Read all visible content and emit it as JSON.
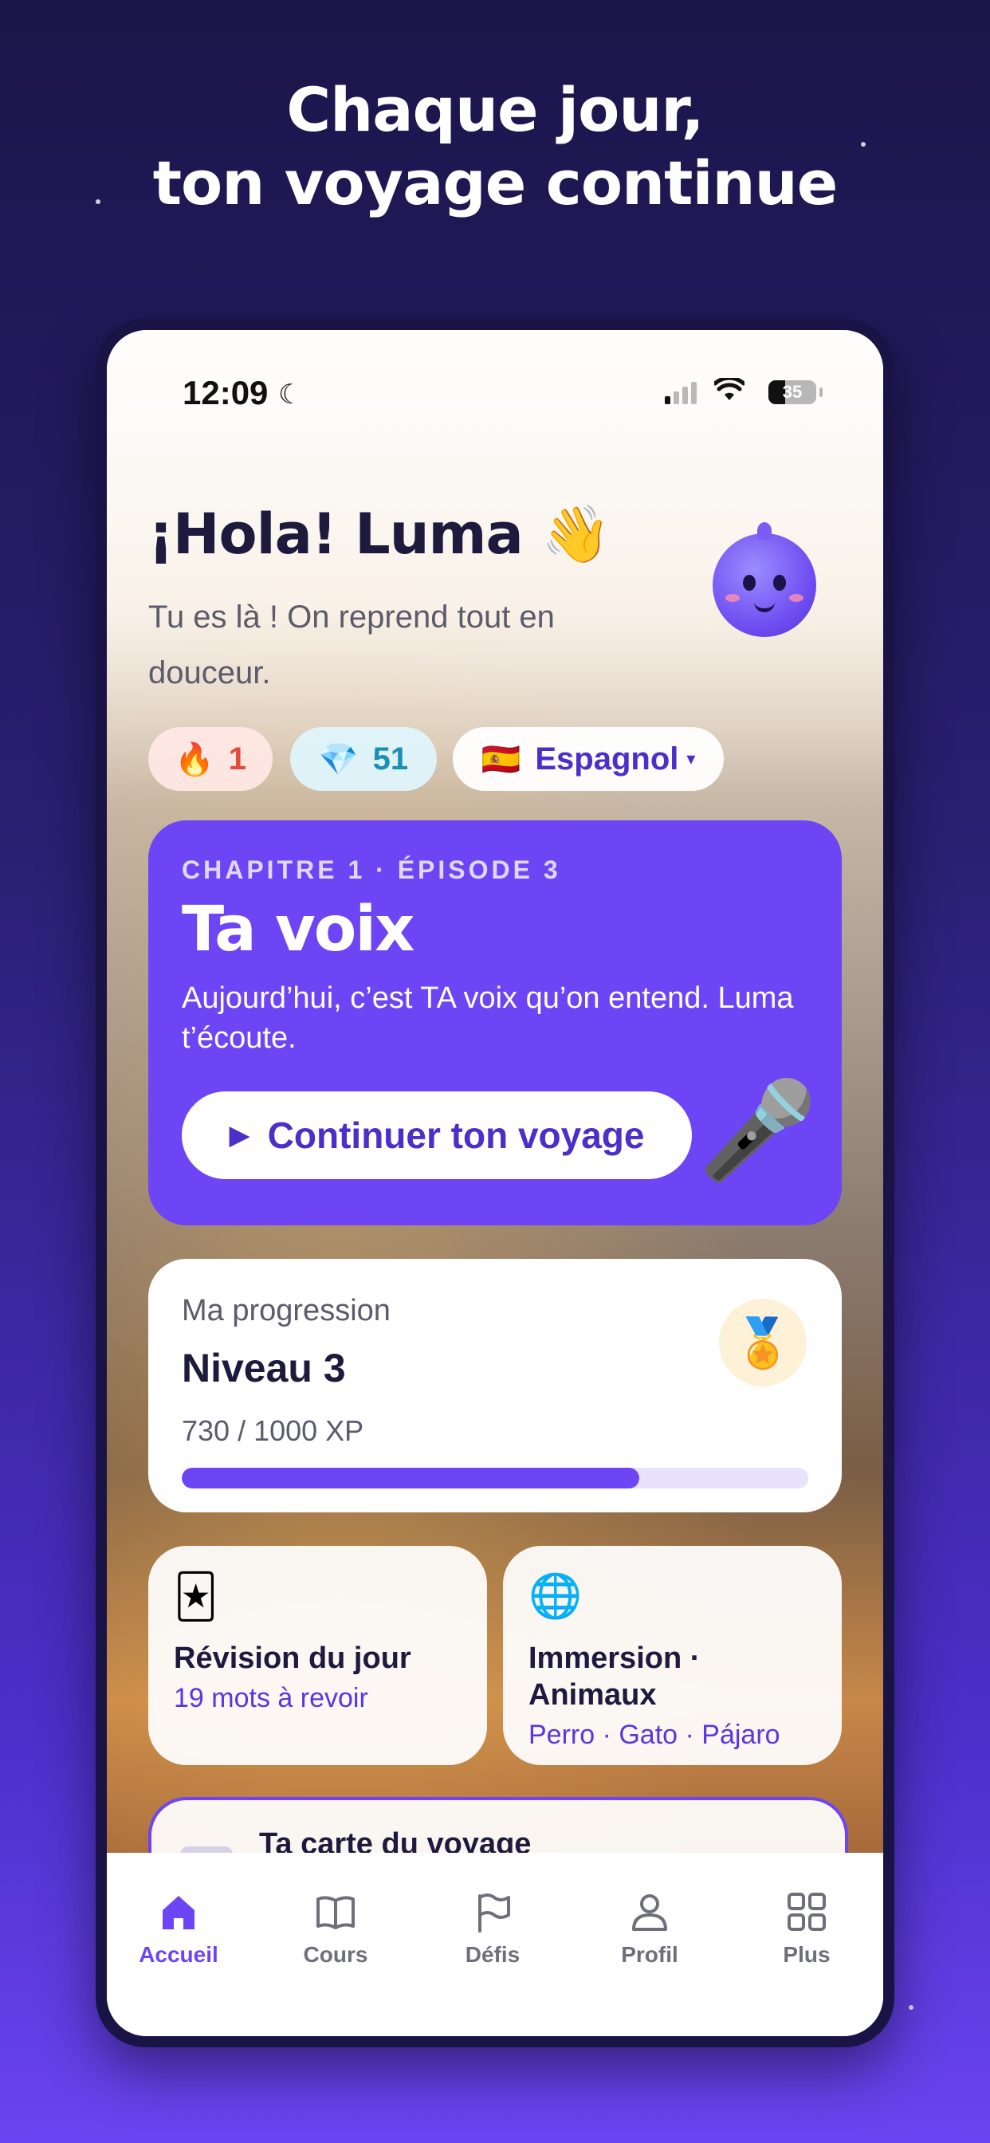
{
  "headline": {
    "line1": "Chaque jour,",
    "line2": "ton voyage continue"
  },
  "status_bar": {
    "time": "12:09",
    "battery_level": "35",
    "battery_percent": 35
  },
  "greeting": {
    "title": "¡Hola! Luma 👋",
    "subtitle": "Tu es là ! On reprend tout en douceur."
  },
  "stats": {
    "streak": {
      "icon": "🔥",
      "value": "1"
    },
    "gems": {
      "icon": "💎",
      "value": "51"
    },
    "language": {
      "flag": "🇪🇸",
      "label": "Espagnol",
      "caret": "▾"
    }
  },
  "chapter_card": {
    "kicker": "CHAPITRE 1 · ÉPISODE 3",
    "title": "Ta voix",
    "description": "Aujourd’hui, c’est TA voix qu’on entend. Luma t’écoute.",
    "cta_icon": "▶",
    "cta_label": "Continuer ton voyage",
    "illustration": "🎤"
  },
  "progress_card": {
    "label": "Ma progression",
    "level": "Niveau 3",
    "xp_text": "730 / 1000 XP",
    "xp_fraction": 0.73,
    "badge": "🏅"
  },
  "tiles": {
    "review": {
      "icon": "🃏",
      "title": "Révision du jour",
      "subtitle": "19 mots à revoir"
    },
    "immersion": {
      "icon": "🌐",
      "title": "Immersion · Animaux",
      "subtitle": "Perro · Gato · Pájaro"
    }
  },
  "map_card": {
    "title": "Ta carte du voyage"
  },
  "tab_bar": {
    "items": [
      {
        "label": "Accueil",
        "icon": "home-icon"
      },
      {
        "label": "Cours",
        "icon": "book-icon"
      },
      {
        "label": "Défis",
        "icon": "flag-icon"
      },
      {
        "label": "Profil",
        "icon": "person-icon"
      },
      {
        "label": "Plus",
        "icon": "grid-icon"
      }
    ]
  },
  "colors": {
    "accent": "#6d45f5",
    "background_top": "#1c1549",
    "background_bottom": "#6a44f0"
  }
}
